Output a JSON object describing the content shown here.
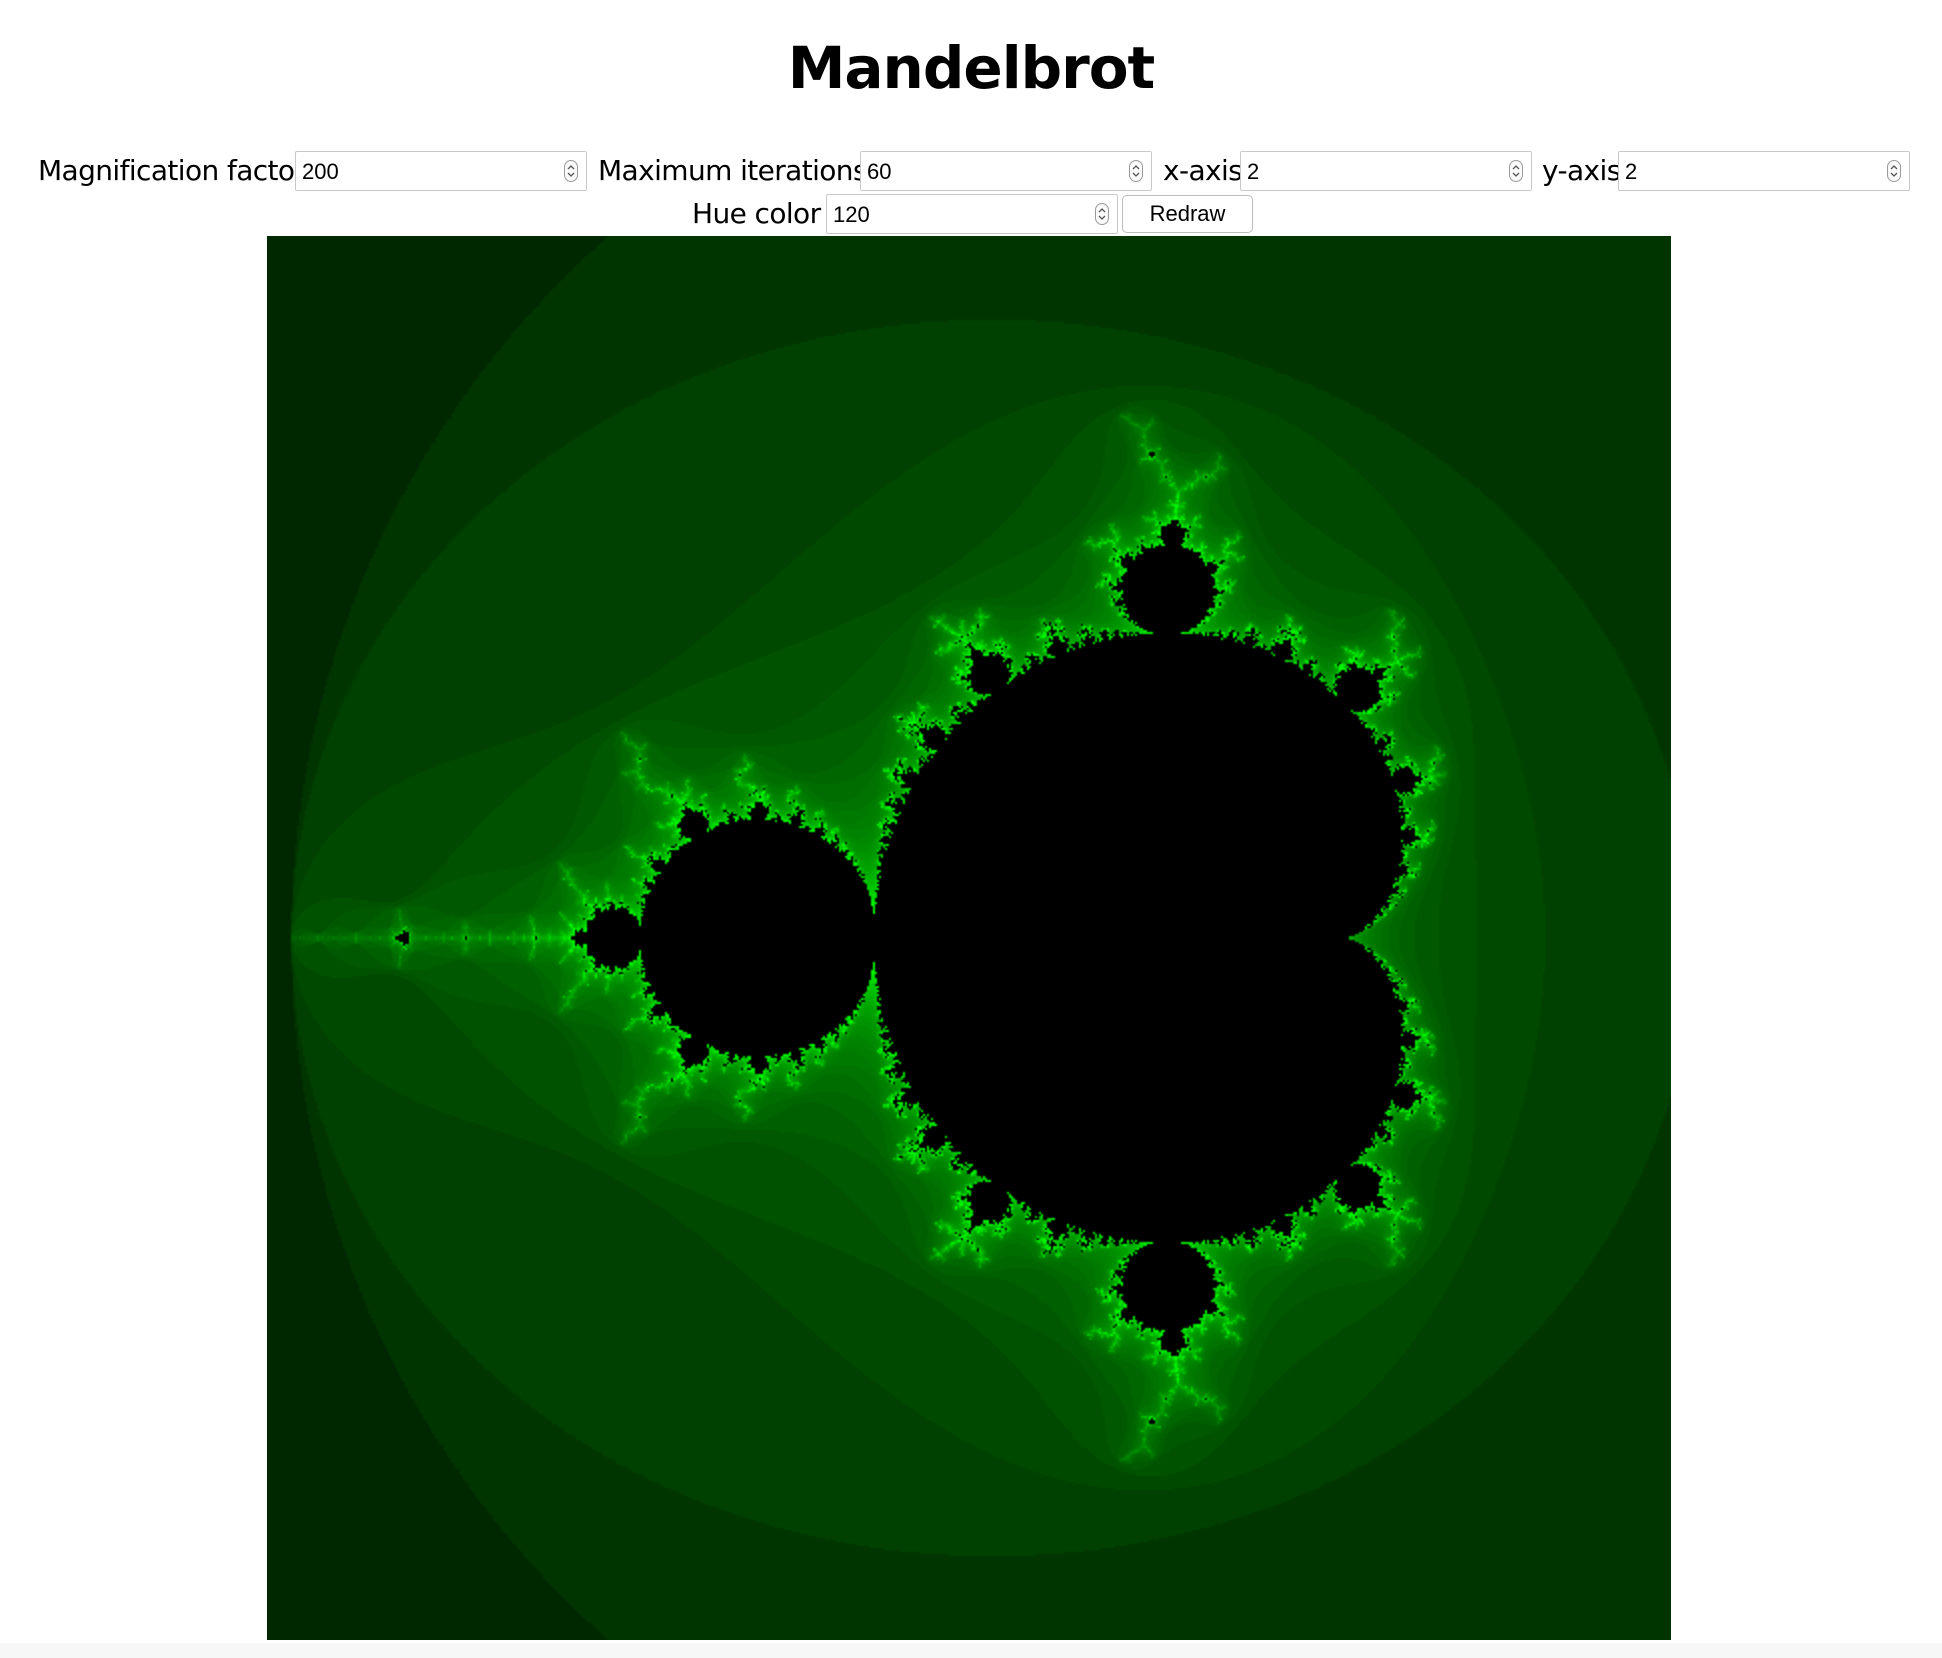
{
  "title": "Mandelbrot",
  "controls": {
    "magnification": {
      "label": "Magnification factor",
      "value": "200"
    },
    "max_iterations": {
      "label": "Maximum iterations",
      "value": "60"
    },
    "x_axis": {
      "label": "x-axis",
      "value": "2"
    },
    "y_axis": {
      "label": "y-axis",
      "value": "2"
    },
    "hue": {
      "label": "Hue color",
      "value": "120"
    },
    "redraw_label": "Redraw"
  },
  "icons": {
    "spinner": "up-down-stepper-icon"
  },
  "colors": {
    "hue_green": "#22c42a",
    "set_fill": "#000000"
  }
}
